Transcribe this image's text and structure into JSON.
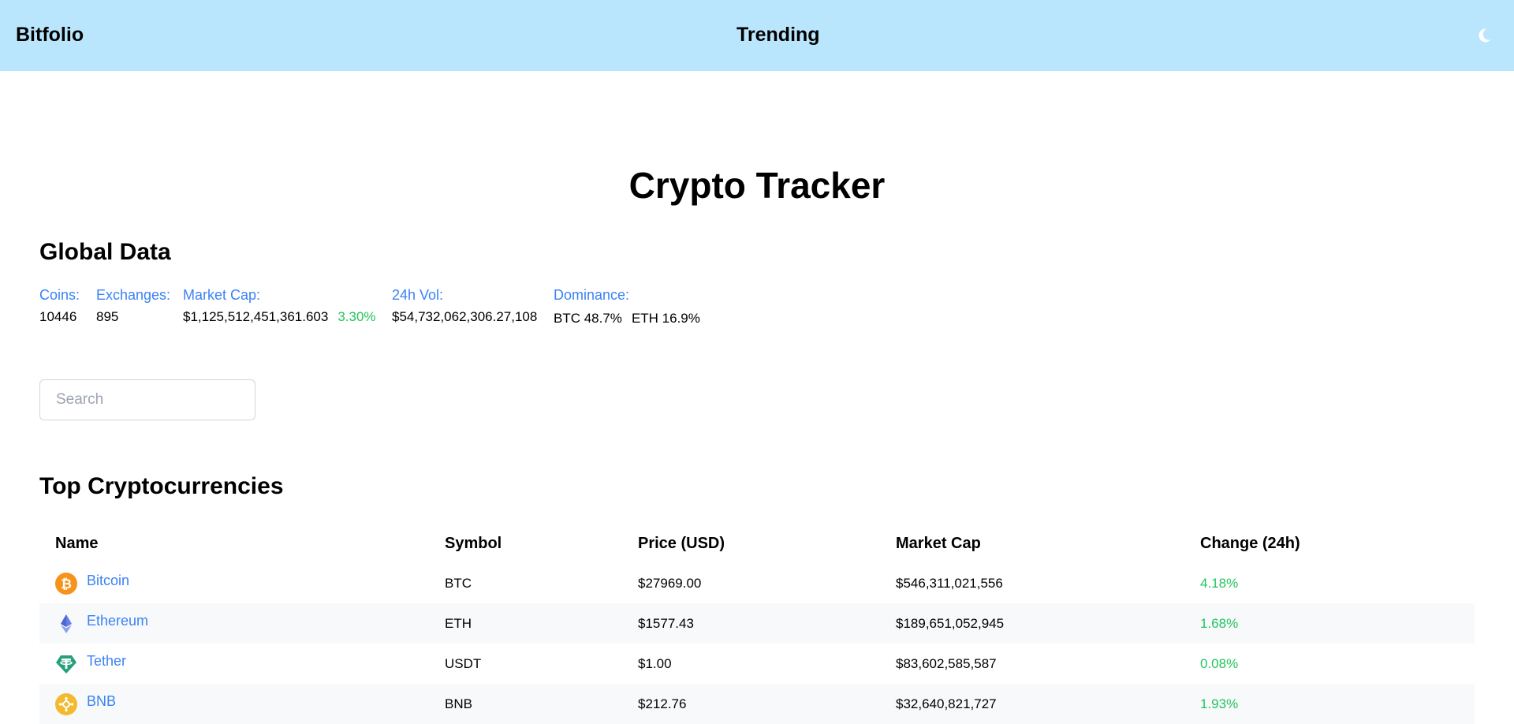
{
  "nav": {
    "brand": "Bitfolio",
    "trending": "Trending",
    "theme_icon": "moon-icon"
  },
  "page_title": "Crypto Tracker",
  "global": {
    "title": "Global Data",
    "coins_label": "Coins:",
    "coins_value": "10446",
    "exchanges_label": "Exchanges:",
    "exchanges_value": "895",
    "market_cap_label": "Market Cap:",
    "market_cap_value": "$1,125,512,451,361.603",
    "market_cap_change": "3.30%",
    "volume_label": "24h Vol:",
    "volume_value": "$54,732,062,306.27,108",
    "dominance_label": "Dominance:",
    "dominance_btc": "BTC 48.7%",
    "dominance_eth": "ETH 16.9%"
  },
  "search": {
    "placeholder": "Search",
    "value": ""
  },
  "list": {
    "title": "Top Cryptocurrencies",
    "headers": {
      "name": "Name",
      "symbol": "Symbol",
      "price": "Price (USD)",
      "market_cap": "Market Cap",
      "change": "Change (24h)"
    },
    "rows": [
      {
        "name": "Bitcoin",
        "symbol": "BTC",
        "price": "$27969.00",
        "market_cap": "$546,311,021,556",
        "change": "4.18%",
        "icon": "bitcoin-icon"
      },
      {
        "name": "Ethereum",
        "symbol": "ETH",
        "price": "$1577.43",
        "market_cap": "$189,651,052,945",
        "change": "1.68%",
        "icon": "ethereum-icon"
      },
      {
        "name": "Tether",
        "symbol": "USDT",
        "price": "$1.00",
        "market_cap": "$83,602,585,587",
        "change": "0.08%",
        "icon": "tether-icon"
      },
      {
        "name": "BNB",
        "symbol": "BNB",
        "price": "$212.76",
        "market_cap": "$32,640,821,727",
        "change": "1.93%",
        "icon": "bnb-icon"
      }
    ]
  },
  "colors": {
    "navbar_bg": "#bae6fd",
    "link": "#3b82f6",
    "positive": "#22c55e",
    "bitcoin": "#f7931a",
    "ethereum": "#627eea",
    "tether": "#26a17b",
    "bnb": "#f3ba2f"
  }
}
